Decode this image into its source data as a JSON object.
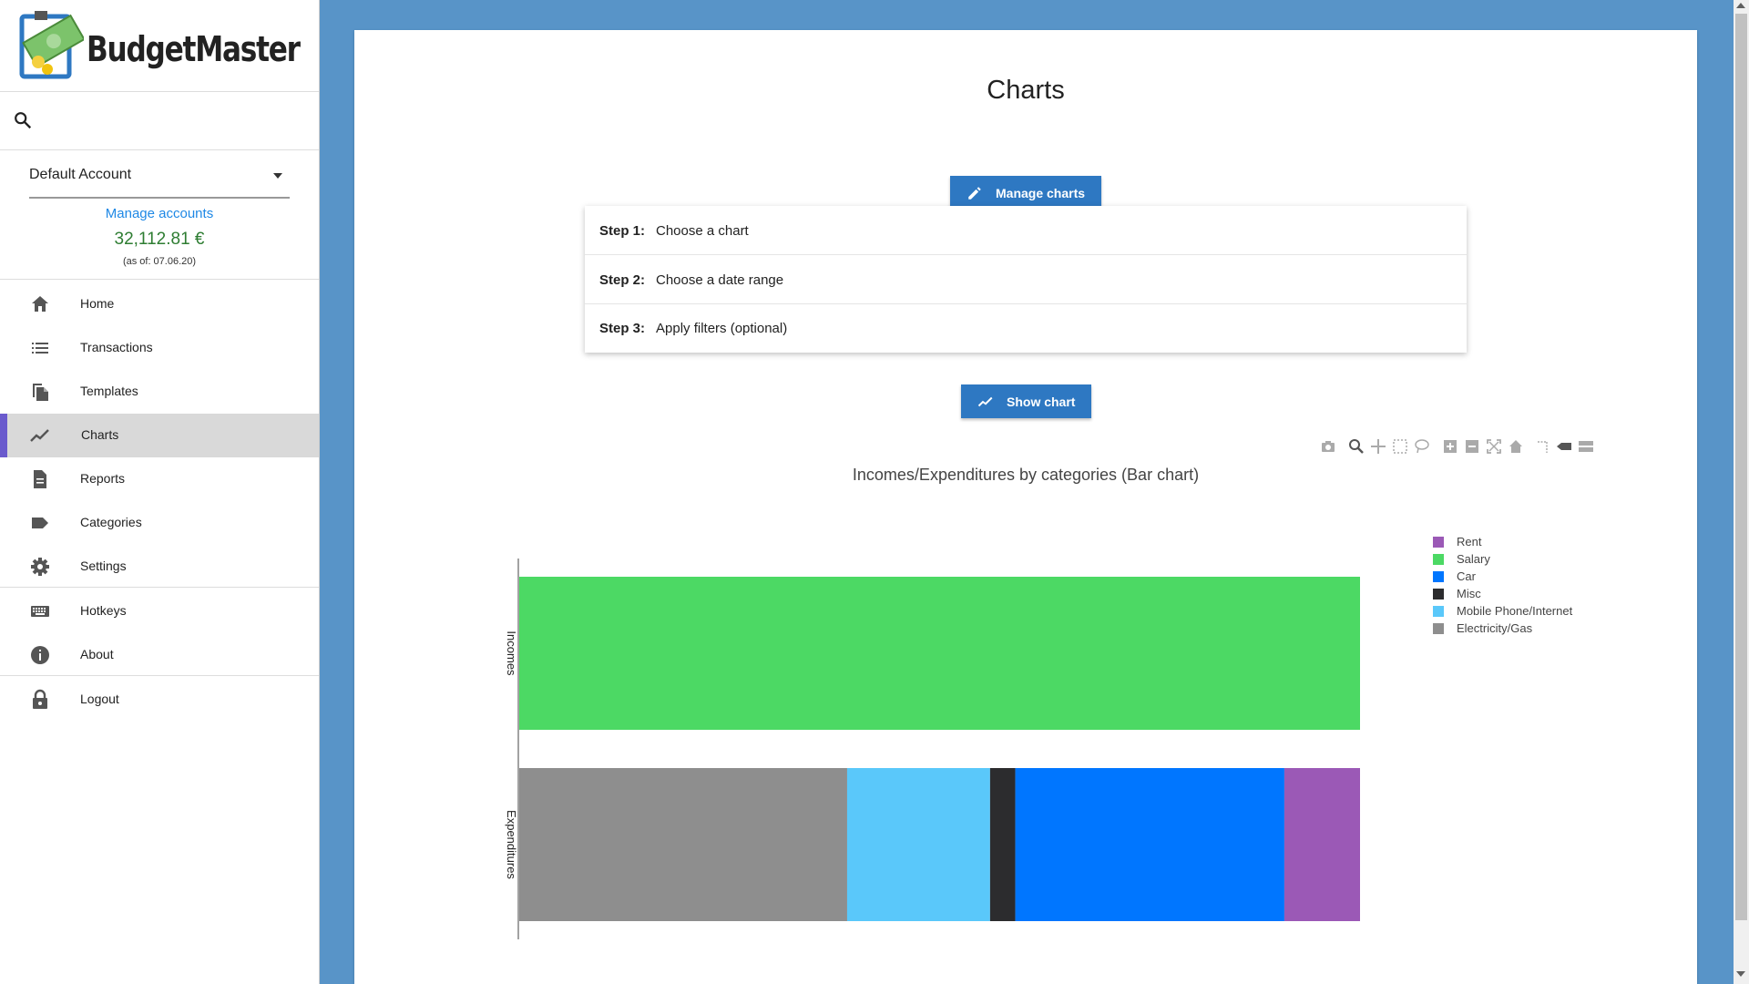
{
  "app": {
    "name": "BudgetMaster"
  },
  "sidebar": {
    "account": "Default Account",
    "manage_accounts": "Manage accounts",
    "balance": "32,112.81 €",
    "as_of": "(as of: 07.06.20)",
    "items": [
      {
        "label": "Home",
        "icon": "home-icon"
      },
      {
        "label": "Transactions",
        "icon": "list-icon"
      },
      {
        "label": "Templates",
        "icon": "file-copy-icon"
      },
      {
        "label": "Charts",
        "icon": "line-chart-icon",
        "active": true
      },
      {
        "label": "Reports",
        "icon": "document-icon"
      },
      {
        "label": "Categories",
        "icon": "tag-icon"
      },
      {
        "label": "Settings",
        "icon": "gear-icon"
      },
      {
        "label": "Hotkeys",
        "icon": "keyboard-icon"
      },
      {
        "label": "About",
        "icon": "info-icon"
      },
      {
        "label": "Logout",
        "icon": "lock-icon"
      }
    ]
  },
  "main": {
    "title": "Charts",
    "manage_charts": "Manage charts",
    "show_chart": "Show chart",
    "steps": [
      {
        "num": "Step 1:",
        "text": "Choose a chart"
      },
      {
        "num": "Step 2:",
        "text": "Choose a date range"
      },
      {
        "num": "Step 3:",
        "text": "Apply filters (optional)"
      }
    ]
  },
  "colors": {
    "sidebar_active": "#d9d9d9",
    "active_indicator": "#6a5acd",
    "main_background": "#5894c8",
    "button": "#2e78c2",
    "balance": "#2e7d32",
    "link": "#1e88e5"
  },
  "chart_data": {
    "type": "bar",
    "orientation": "horizontal",
    "stacked": true,
    "title": "Incomes/Expenditures by categories (Bar chart)",
    "categories": [
      "Incomes",
      "Expenditures"
    ],
    "legend_position": "right",
    "series": [
      {
        "name": "Rent",
        "color": "#9b59b6",
        "values": [
          0,
          9
        ]
      },
      {
        "name": "Salary",
        "color": "#4cd964",
        "values": [
          100,
          0
        ]
      },
      {
        "name": "Car",
        "color": "#0076ff",
        "values": [
          0,
          32
        ]
      },
      {
        "name": "Misc",
        "color": "#2c2c2e",
        "values": [
          0,
          3
        ]
      },
      {
        "name": "Mobile Phone/Internet",
        "color": "#5ac8fa",
        "values": [
          0,
          17
        ]
      },
      {
        "name": "Electricity/Gas",
        "color": "#8e8e8e",
        "values": [
          0,
          39
        ]
      }
    ],
    "stack_order": [
      "Electricity/Gas",
      "Mobile Phone/Internet",
      "Misc",
      "Car",
      "Rent",
      "Salary"
    ]
  }
}
